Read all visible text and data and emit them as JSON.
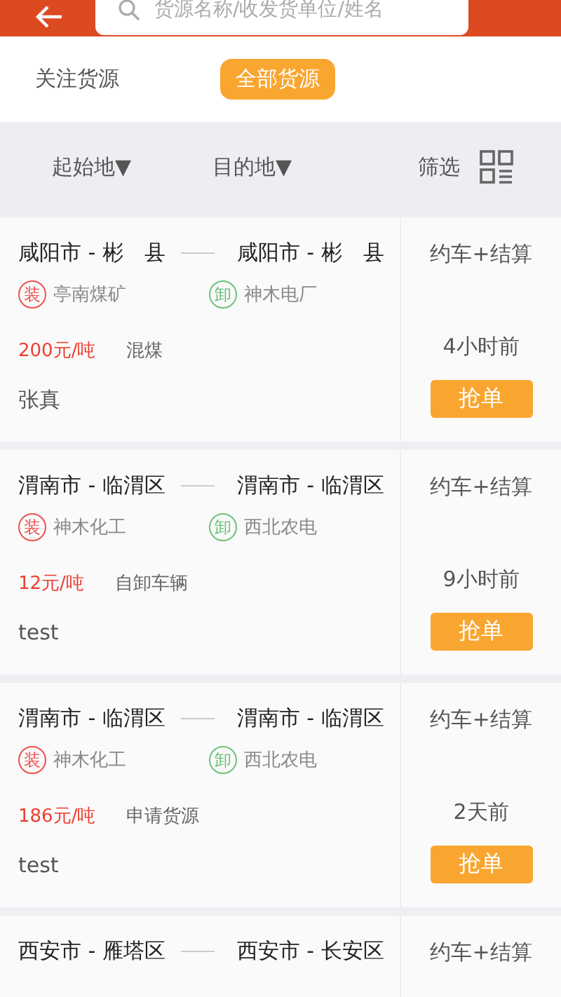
{
  "search": {
    "placeholder": "货源名称/收发货单位/姓名"
  },
  "tabs": [
    {
      "label": "关注货源",
      "selected": false
    },
    {
      "label": "全部货源",
      "selected": true
    }
  ],
  "filters": [
    {
      "label": "起始地▼"
    },
    {
      "label": "目的地▼"
    },
    {
      "label": "筛选"
    }
  ],
  "cargo": [
    {
      "from": "咸阳市 - 彬　县",
      "to": "咸阳市 - 彬　县",
      "service": "约车+结算",
      "load_badge": "装",
      "load_site": "亭南煤矿",
      "unload_badge": "卸",
      "unload_site": "神木电厂",
      "price": "200元/吨",
      "goods": "混煤",
      "time": "4小时前",
      "contact": "张真",
      "action": "抢单"
    },
    {
      "from": "渭南市 - 临渭区",
      "to": "渭南市 - 临渭区",
      "service": "约车+结算",
      "load_badge": "装",
      "load_site": "神木化工",
      "unload_badge": "卸",
      "unload_site": "西北农电",
      "price": "12元/吨",
      "goods": "自卸车辆",
      "time": "9小时前",
      "contact": "test",
      "action": "抢单"
    },
    {
      "from": "渭南市 - 临渭区",
      "to": "渭南市 - 临渭区",
      "service": "约车+结算",
      "load_badge": "装",
      "load_site": "神木化工",
      "unload_badge": "卸",
      "unload_site": "西北农电",
      "price": "186元/吨",
      "goods": "申请货源",
      "time": "2天前",
      "contact": "test",
      "action": "抢单"
    },
    {
      "from": "西安市 - 雁塔区",
      "to": "西安市 - 长安区",
      "service": "约车+结算"
    }
  ]
}
